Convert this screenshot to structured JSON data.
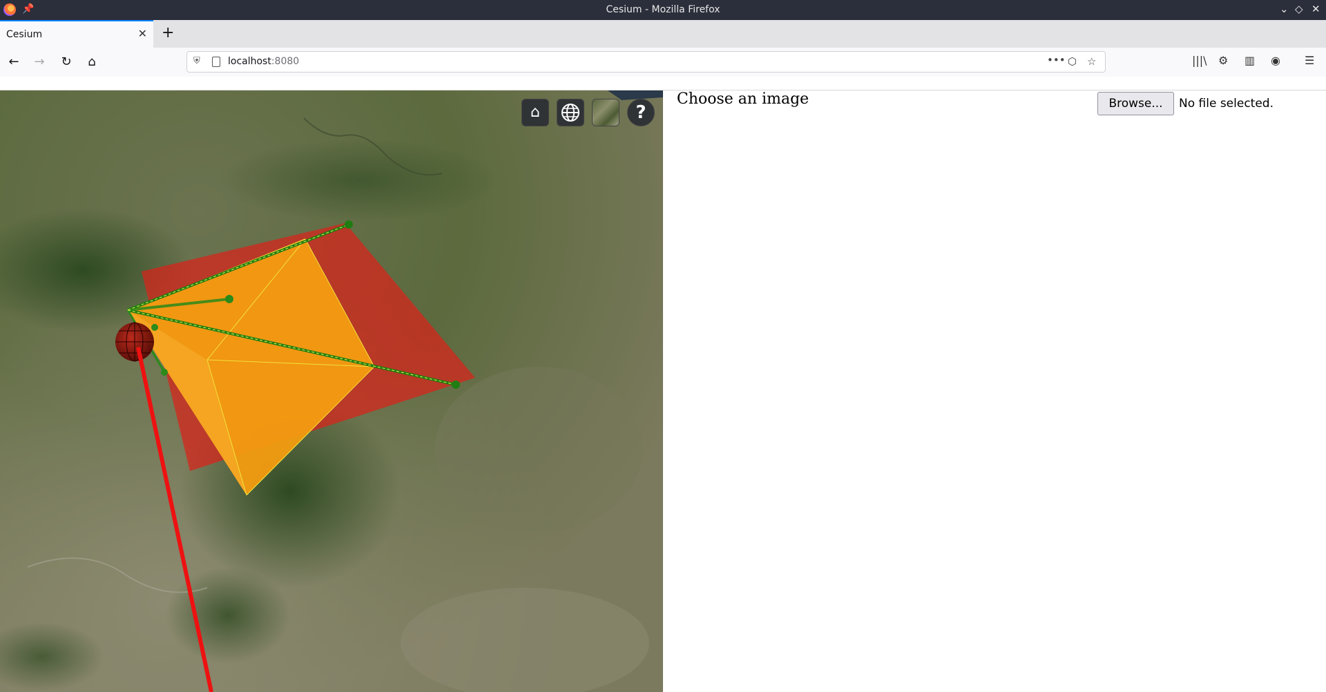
{
  "window": {
    "title": "Cesium - Mozilla Firefox"
  },
  "tabs": [
    {
      "label": "Cesium"
    }
  ],
  "navbar": {
    "url_host": "localhost",
    "url_port": ":8080"
  },
  "viewer": {
    "controls": [
      {
        "name": "home-button",
        "icon": "home-icon"
      },
      {
        "name": "scene-mode-button",
        "icon": "globe-icon"
      },
      {
        "name": "base-layer-picker",
        "icon": "imagery-icon"
      },
      {
        "name": "navigation-help-button",
        "icon": "help-icon",
        "label": "?"
      }
    ]
  },
  "side": {
    "heading": "Choose an image",
    "browse_label": "Browse...",
    "file_status": "No file selected."
  }
}
